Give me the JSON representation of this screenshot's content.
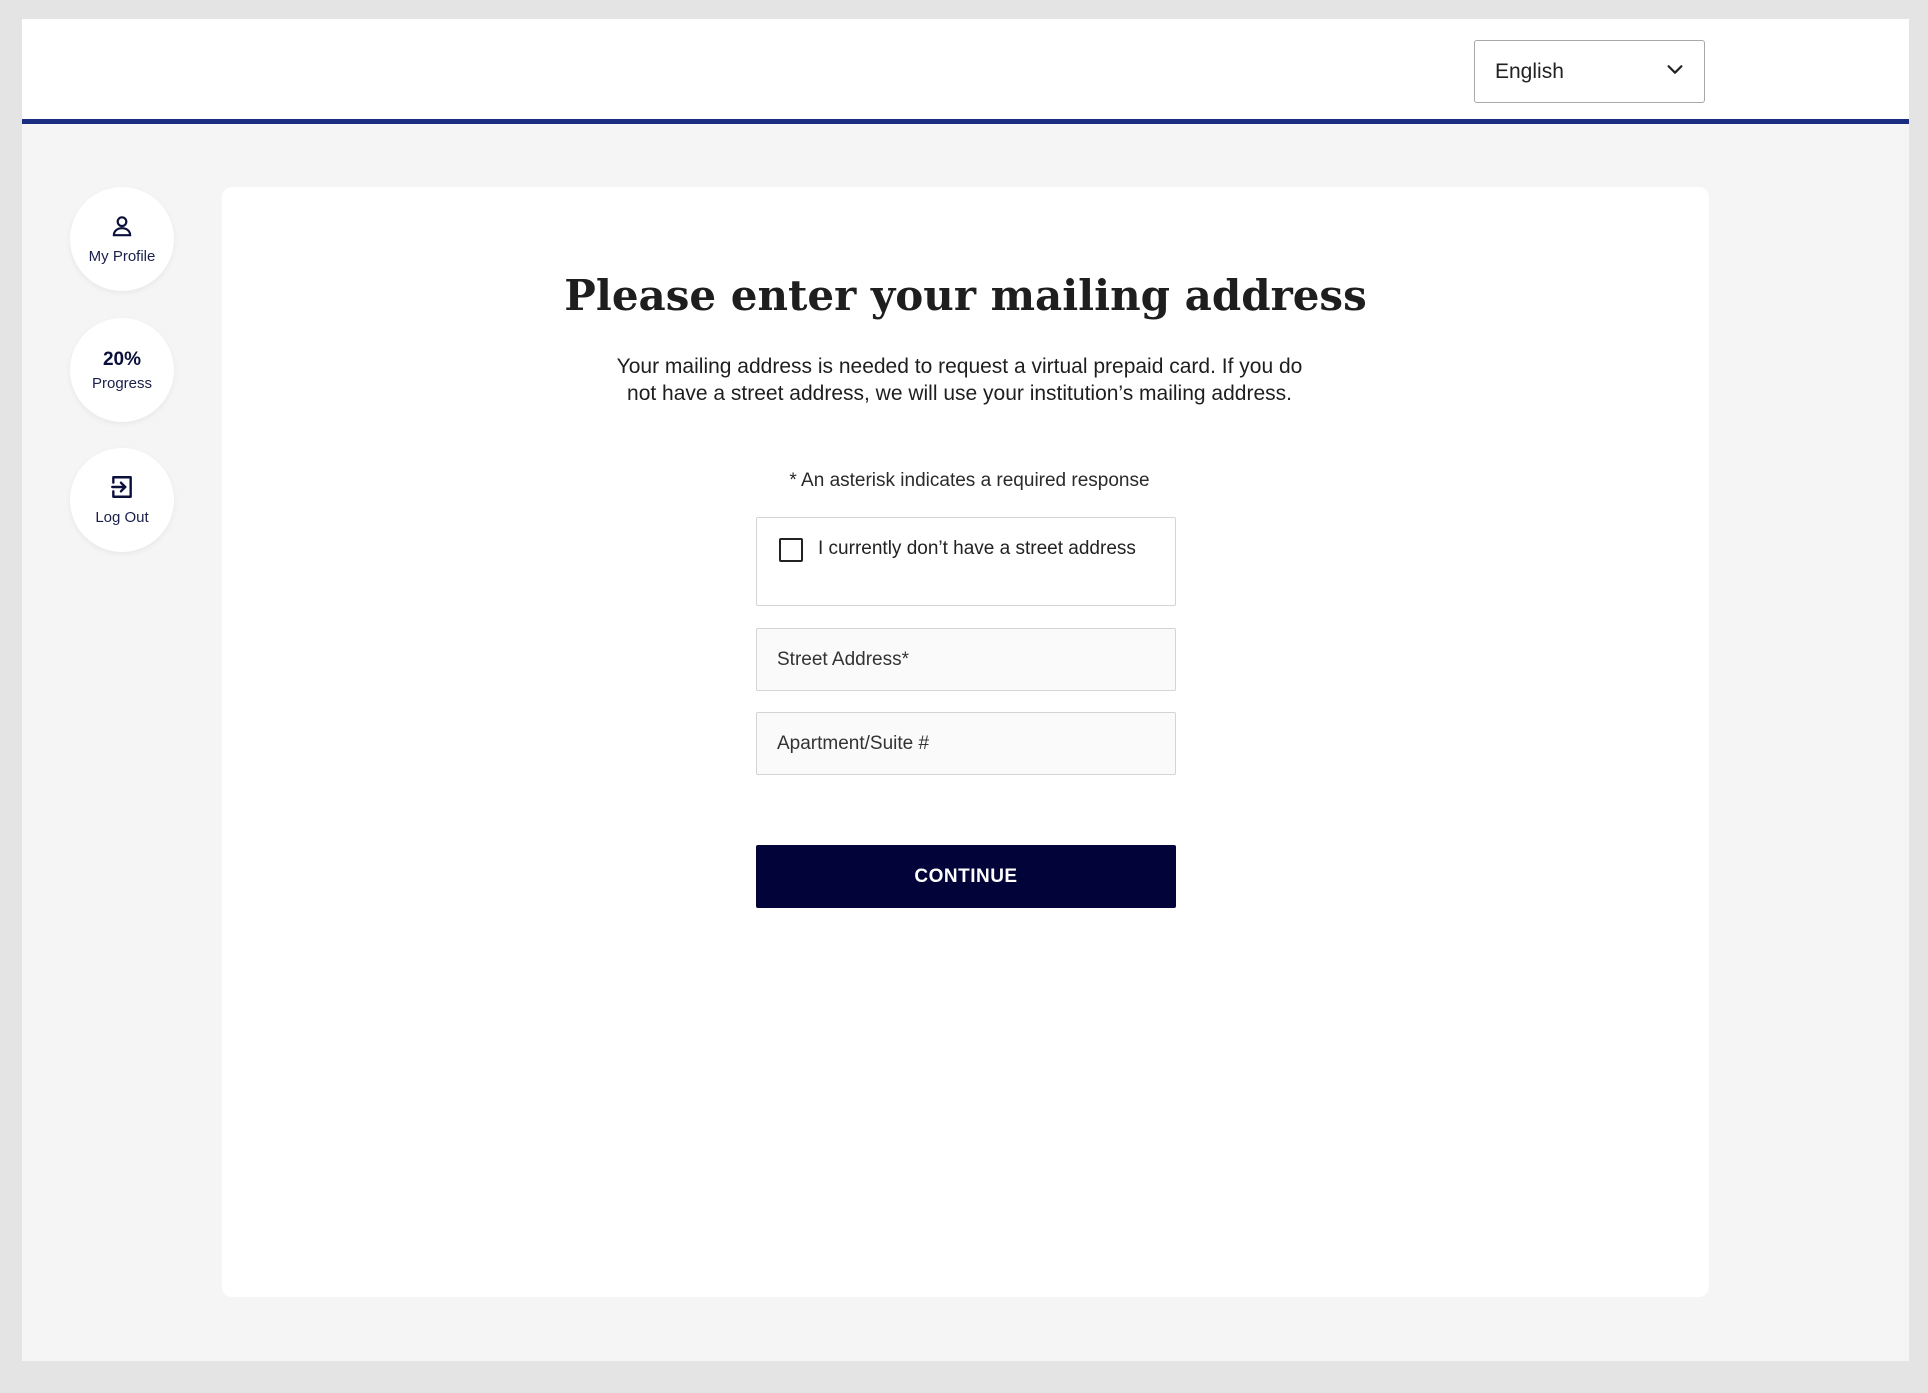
{
  "header": {
    "language": {
      "selected": "English",
      "icon": "chevron-down-icon"
    }
  },
  "sidebar": {
    "profile": {
      "label": "My Profile",
      "icon": "person-icon"
    },
    "progress": {
      "value": "20%",
      "label": "Progress"
    },
    "logout": {
      "label": "Log Out",
      "icon": "logout-icon"
    }
  },
  "form": {
    "title": "Please enter your mailing address",
    "description": "Your mailing address is needed to request a virtual prepaid card. If you do not have a street address, we will use your institution’s mailing address.",
    "required_note": "* An asterisk indicates a required response",
    "no_street_checkbox": {
      "label": "I currently don’t have a street address",
      "checked": false
    },
    "street_address": {
      "placeholder": "Street Address*",
      "value": ""
    },
    "apartment": {
      "placeholder": "Apartment/Suite #",
      "value": ""
    },
    "continue_label": "CONTINUE"
  },
  "colors": {
    "accent_bar": "#1b2d80",
    "primary_button": "#020338"
  }
}
